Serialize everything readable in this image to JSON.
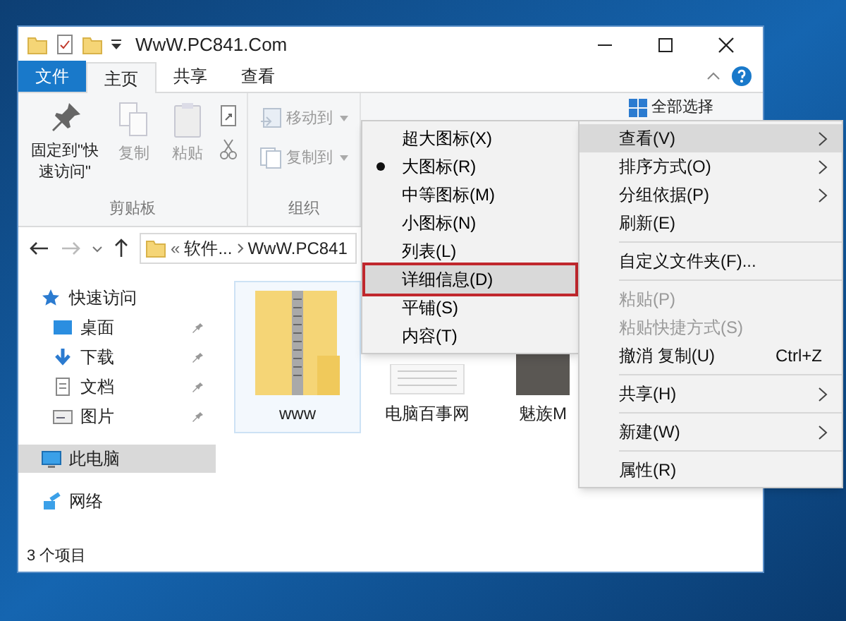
{
  "window": {
    "title": "WwW.PC841.Com"
  },
  "tabs": [
    {
      "label": "文件",
      "kind": "file",
      "selected": false
    },
    {
      "label": "主页",
      "kind": "tab",
      "selected": true
    },
    {
      "label": "共享",
      "kind": "tab",
      "selected": false
    },
    {
      "label": "查看",
      "kind": "tab",
      "selected": false
    }
  ],
  "ribbon": {
    "groups": [
      {
        "label": "剪贴板",
        "buttons": [
          {
            "label": "固定到\"快速访问\"",
            "disabled": false
          },
          {
            "label": "复制",
            "disabled": true
          },
          {
            "label": "粘贴",
            "disabled": true
          }
        ]
      },
      {
        "label": "组织",
        "buttons": [
          {
            "label": "移动到",
            "disabled": true
          },
          {
            "label": "复制到",
            "disabled": true
          }
        ]
      }
    ],
    "select_all": "全部选择"
  },
  "address_bar": {
    "prefix": "«",
    "segments": [
      "软件...",
      "WwW.PC841"
    ]
  },
  "nav_pane": {
    "items": [
      {
        "label": "快速访问",
        "pinned": false,
        "selected": false,
        "children": [
          {
            "label": "桌面",
            "pinned": true,
            "selected": false
          },
          {
            "label": "下载",
            "pinned": true,
            "selected": false
          },
          {
            "label": "文档",
            "pinned": true,
            "selected": false
          },
          {
            "label": "图片",
            "pinned": true,
            "selected": false
          }
        ]
      },
      {
        "label": "此电脑",
        "pinned": false,
        "selected": true
      },
      {
        "label": "网络",
        "pinned": false,
        "selected": false
      }
    ]
  },
  "files": [
    {
      "name": "www",
      "kind": "zip",
      "selected": true
    },
    {
      "name": "电脑百事网",
      "kind": "document",
      "selected": false
    },
    {
      "name": "魅族M",
      "kind": "photo",
      "selected": false
    }
  ],
  "status_bar": "3 个项目",
  "view_submenu": [
    {
      "label": "超大图标(X)",
      "checked": false,
      "highlighted": false
    },
    {
      "label": "大图标(R)",
      "checked": true,
      "highlighted": false
    },
    {
      "label": "中等图标(M)",
      "checked": false,
      "highlighted": false
    },
    {
      "label": "小图标(N)",
      "checked": false,
      "highlighted": false
    },
    {
      "label": "列表(L)",
      "checked": false,
      "highlighted": false
    },
    {
      "label": "详细信息(D)",
      "checked": false,
      "highlighted": true
    },
    {
      "label": "平铺(S)",
      "checked": false,
      "highlighted": false
    },
    {
      "label": "内容(T)",
      "checked": false,
      "highlighted": false
    }
  ],
  "context_menu": [
    {
      "kind": "item",
      "label": "查看(V)",
      "submenu": true,
      "highlighted": true,
      "disabled": false
    },
    {
      "kind": "item",
      "label": "排序方式(O)",
      "submenu": true,
      "highlighted": false,
      "disabled": false
    },
    {
      "kind": "item",
      "label": "分组依据(P)",
      "submenu": true,
      "highlighted": false,
      "disabled": false
    },
    {
      "kind": "item",
      "label": "刷新(E)",
      "submenu": false,
      "highlighted": false,
      "disabled": false
    },
    {
      "kind": "separator"
    },
    {
      "kind": "item",
      "label": "自定义文件夹(F)...",
      "submenu": false,
      "highlighted": false,
      "disabled": false
    },
    {
      "kind": "separator"
    },
    {
      "kind": "item",
      "label": "粘贴(P)",
      "submenu": false,
      "highlighted": false,
      "disabled": true
    },
    {
      "kind": "item",
      "label": "粘贴快捷方式(S)",
      "submenu": false,
      "highlighted": false,
      "disabled": true
    },
    {
      "kind": "item",
      "label": "撤消 复制(U)",
      "shortcut": "Ctrl+Z",
      "submenu": false,
      "highlighted": false,
      "disabled": false
    },
    {
      "kind": "separator"
    },
    {
      "kind": "item",
      "label": "共享(H)",
      "submenu": true,
      "highlighted": false,
      "disabled": false
    },
    {
      "kind": "separator"
    },
    {
      "kind": "item",
      "label": "新建(W)",
      "submenu": true,
      "highlighted": false,
      "disabled": false
    },
    {
      "kind": "separator"
    },
    {
      "kind": "item",
      "label": "属性(R)",
      "submenu": false,
      "highlighted": false,
      "disabled": false
    }
  ]
}
